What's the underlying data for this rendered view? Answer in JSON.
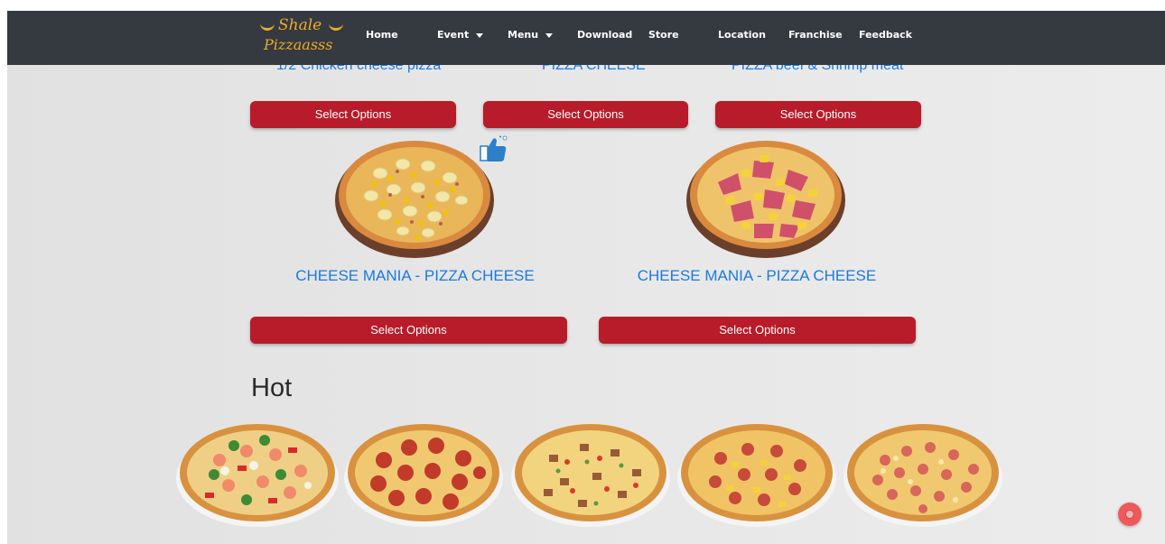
{
  "brand": {
    "line1": "Shale",
    "line2": "Pizzaasss"
  },
  "nav": {
    "home": "Home",
    "event": "Event",
    "menu": "Menu",
    "download": "Download",
    "store": "Store",
    "location": "Location",
    "franchise": "Franchise",
    "feedback": "Feedback"
  },
  "top_products": [
    {
      "title": "1/2 Chicken cheese pizza",
      "button": "Select Options"
    },
    {
      "title": "PIZZA CHEESE",
      "button": "Select Options"
    },
    {
      "title": "PIZZA beef & Shrimp meat",
      "button": "Select Options"
    }
  ],
  "featured_products": [
    {
      "title": "CHEESE MANIA - PIZZA CHEESE",
      "button": "Select Options"
    },
    {
      "title": "CHEESE MANIA - PIZZA CHEESE",
      "button": "Select Options"
    }
  ],
  "hot_section": {
    "title": "Hot"
  },
  "colors": {
    "navbar": "#343a40",
    "button": "#b81b2a",
    "link": "#1a7ae0",
    "logo": "#f0a92a",
    "float_button": "#ee5a5a"
  }
}
